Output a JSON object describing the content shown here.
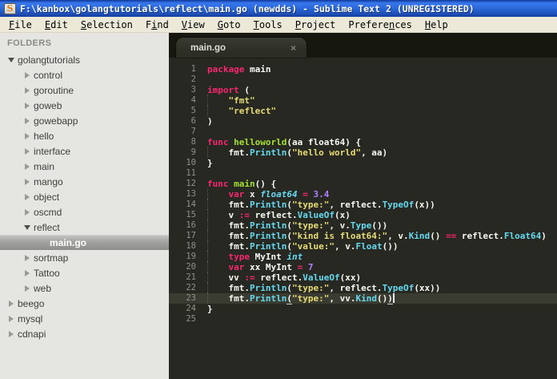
{
  "window": {
    "title": "F:\\kanbox\\golangtutorials\\reflect\\main.go (newdds) - Sublime Text 2 (UNREGISTERED)",
    "app_icon_glyph": "S"
  },
  "menubar": {
    "items": [
      {
        "label": "File",
        "mnemonic_index": 0
      },
      {
        "label": "Edit",
        "mnemonic_index": 0
      },
      {
        "label": "Selection",
        "mnemonic_index": 0
      },
      {
        "label": "Find",
        "mnemonic_index": 1
      },
      {
        "label": "View",
        "mnemonic_index": 0
      },
      {
        "label": "Goto",
        "mnemonic_index": 0
      },
      {
        "label": "Tools",
        "mnemonic_index": 0
      },
      {
        "label": "Project",
        "mnemonic_index": 0
      },
      {
        "label": "Preferences",
        "mnemonic_index": 7
      },
      {
        "label": "Help",
        "mnemonic_index": 0
      }
    ]
  },
  "sidebar": {
    "header": "FOLDERS",
    "items": [
      {
        "label": "golangtutorials",
        "level": 0,
        "type": "folder",
        "state": "expanded",
        "selected": false
      },
      {
        "label": "control",
        "level": 1,
        "type": "folder",
        "state": "collapsed",
        "selected": false
      },
      {
        "label": "goroutine",
        "level": 1,
        "type": "folder",
        "state": "collapsed",
        "selected": false
      },
      {
        "label": "goweb",
        "level": 1,
        "type": "folder",
        "state": "collapsed",
        "selected": false
      },
      {
        "label": "gowebapp",
        "level": 1,
        "type": "folder",
        "state": "collapsed",
        "selected": false
      },
      {
        "label": "hello",
        "level": 1,
        "type": "folder",
        "state": "collapsed",
        "selected": false
      },
      {
        "label": "interface",
        "level": 1,
        "type": "folder",
        "state": "collapsed",
        "selected": false
      },
      {
        "label": "main",
        "level": 1,
        "type": "folder",
        "state": "collapsed",
        "selected": false
      },
      {
        "label": "mango",
        "level": 1,
        "type": "folder",
        "state": "collapsed",
        "selected": false
      },
      {
        "label": "object",
        "level": 1,
        "type": "folder",
        "state": "collapsed",
        "selected": false
      },
      {
        "label": "oscmd",
        "level": 1,
        "type": "folder",
        "state": "collapsed",
        "selected": false
      },
      {
        "label": "reflect",
        "level": 1,
        "type": "folder",
        "state": "expanded",
        "selected": false
      },
      {
        "label": "main.go",
        "level": 2,
        "type": "file",
        "state": "none",
        "selected": true
      },
      {
        "label": "sortmap",
        "level": 1,
        "type": "folder",
        "state": "collapsed",
        "selected": false
      },
      {
        "label": "Tattoo",
        "level": 1,
        "type": "folder",
        "state": "collapsed",
        "selected": false
      },
      {
        "label": "web",
        "level": 1,
        "type": "folder",
        "state": "collapsed",
        "selected": false
      },
      {
        "label": "beego",
        "level": 0,
        "type": "folder",
        "state": "collapsed",
        "selected": false
      },
      {
        "label": "mysql",
        "level": 0,
        "type": "folder",
        "state": "collapsed",
        "selected": false
      },
      {
        "label": "cdnapi",
        "level": 0,
        "type": "folder",
        "state": "collapsed",
        "selected": false
      }
    ]
  },
  "editor": {
    "tab": {
      "label": "main.go",
      "close_glyph": "×",
      "active": true
    },
    "code": {
      "language": "go",
      "lines": [
        {
          "n": 1,
          "g": false,
          "cur": false,
          "seg": [
            [
              "kw",
              "package"
            ],
            [
              "p",
              " main"
            ]
          ]
        },
        {
          "n": 2,
          "g": false,
          "cur": false,
          "seg": []
        },
        {
          "n": 3,
          "g": false,
          "cur": false,
          "seg": [
            [
              "kw",
              "import"
            ],
            [
              "p",
              " ("
            ]
          ]
        },
        {
          "n": 4,
          "g": true,
          "cur": false,
          "seg": [
            [
              "p",
              "    "
            ],
            [
              "str",
              "\"fmt\""
            ]
          ]
        },
        {
          "n": 5,
          "g": true,
          "cur": false,
          "seg": [
            [
              "p",
              "    "
            ],
            [
              "str",
              "\"reflect\""
            ]
          ]
        },
        {
          "n": 6,
          "g": false,
          "cur": false,
          "seg": [
            [
              "p",
              ")"
            ]
          ]
        },
        {
          "n": 7,
          "g": false,
          "cur": false,
          "seg": []
        },
        {
          "n": 8,
          "g": false,
          "cur": false,
          "seg": [
            [
              "kw",
              "func"
            ],
            [
              "p",
              " "
            ],
            [
              "fn",
              "helloworld"
            ],
            [
              "p",
              "(aa float64) {"
            ]
          ]
        },
        {
          "n": 9,
          "g": true,
          "cur": false,
          "seg": [
            [
              "p",
              "    fmt."
            ],
            [
              "call",
              "Println"
            ],
            [
              "p",
              "("
            ],
            [
              "str",
              "\"hello world\""
            ],
            [
              "p",
              ", aa)"
            ]
          ]
        },
        {
          "n": 10,
          "g": false,
          "cur": false,
          "seg": [
            [
              "p",
              "}"
            ]
          ]
        },
        {
          "n": 11,
          "g": false,
          "cur": false,
          "seg": []
        },
        {
          "n": 12,
          "g": false,
          "cur": false,
          "seg": [
            [
              "kw",
              "func"
            ],
            [
              "p",
              " "
            ],
            [
              "fn",
              "main"
            ],
            [
              "p",
              "() {"
            ]
          ]
        },
        {
          "n": 13,
          "g": true,
          "cur": false,
          "seg": [
            [
              "p",
              "    "
            ],
            [
              "kw",
              "var"
            ],
            [
              "p",
              " x "
            ],
            [
              "typ",
              "float64"
            ],
            [
              "p",
              " "
            ],
            [
              "kw",
              "="
            ],
            [
              "p",
              " "
            ],
            [
              "num",
              "3.4"
            ]
          ]
        },
        {
          "n": 14,
          "g": true,
          "cur": false,
          "seg": [
            [
              "p",
              "    fmt."
            ],
            [
              "call",
              "Println"
            ],
            [
              "p",
              "("
            ],
            [
              "str",
              "\"type:\""
            ],
            [
              "p",
              ", reflect."
            ],
            [
              "call",
              "TypeOf"
            ],
            [
              "p",
              "(x))"
            ]
          ]
        },
        {
          "n": 15,
          "g": true,
          "cur": false,
          "seg": [
            [
              "p",
              "    v "
            ],
            [
              "kw",
              ":="
            ],
            [
              "p",
              " reflect."
            ],
            [
              "call",
              "ValueOf"
            ],
            [
              "p",
              "(x)"
            ]
          ]
        },
        {
          "n": 16,
          "g": true,
          "cur": false,
          "seg": [
            [
              "p",
              "    fmt."
            ],
            [
              "call",
              "Println"
            ],
            [
              "p",
              "("
            ],
            [
              "str",
              "\"type:\""
            ],
            [
              "p",
              ", v."
            ],
            [
              "call",
              "Type"
            ],
            [
              "p",
              "())"
            ]
          ]
        },
        {
          "n": 17,
          "g": true,
          "cur": false,
          "seg": [
            [
              "p",
              "    fmt."
            ],
            [
              "call",
              "Println"
            ],
            [
              "p",
              "("
            ],
            [
              "str",
              "\"kind is float64:\""
            ],
            [
              "p",
              ", v."
            ],
            [
              "call",
              "Kind"
            ],
            [
              "p",
              "() "
            ],
            [
              "kw",
              "=="
            ],
            [
              "p",
              " reflect."
            ],
            [
              "call",
              "Float64"
            ],
            [
              "p",
              ")"
            ]
          ]
        },
        {
          "n": 18,
          "g": true,
          "cur": false,
          "seg": [
            [
              "p",
              "    fmt."
            ],
            [
              "call",
              "Println"
            ],
            [
              "p",
              "("
            ],
            [
              "str",
              "\"value:\""
            ],
            [
              "p",
              ", v."
            ],
            [
              "call",
              "Float"
            ],
            [
              "p",
              "())"
            ]
          ]
        },
        {
          "n": 19,
          "g": true,
          "cur": false,
          "seg": [
            [
              "p",
              "    "
            ],
            [
              "kw",
              "type"
            ],
            [
              "p",
              " MyInt "
            ],
            [
              "typ",
              "int"
            ]
          ]
        },
        {
          "n": 20,
          "g": true,
          "cur": false,
          "seg": [
            [
              "p",
              "    "
            ],
            [
              "kw",
              "var"
            ],
            [
              "p",
              " xx MyInt "
            ],
            [
              "kw",
              "="
            ],
            [
              "p",
              " "
            ],
            [
              "num",
              "7"
            ]
          ]
        },
        {
          "n": 21,
          "g": true,
          "cur": false,
          "seg": [
            [
              "p",
              "    vv "
            ],
            [
              "kw",
              ":="
            ],
            [
              "p",
              " reflect."
            ],
            [
              "call",
              "ValueOf"
            ],
            [
              "p",
              "(xx)"
            ]
          ]
        },
        {
          "n": 22,
          "g": true,
          "cur": false,
          "seg": [
            [
              "p",
              "    fmt."
            ],
            [
              "call",
              "Println"
            ],
            [
              "p",
              "("
            ],
            [
              "str",
              "\"type:\""
            ],
            [
              "p",
              ", reflect."
            ],
            [
              "call",
              "TypeOf"
            ],
            [
              "p",
              "(xx))"
            ]
          ]
        },
        {
          "n": 23,
          "g": true,
          "cur": true,
          "seg": [
            [
              "p",
              "    fmt."
            ],
            [
              "call",
              "Println"
            ],
            [
              "pu",
              "("
            ],
            [
              "str",
              "\"type:\""
            ],
            [
              "p",
              ", vv."
            ],
            [
              "call",
              "Kind"
            ],
            [
              "p",
              "()"
            ],
            [
              "pu",
              ")"
            ],
            [
              "caret",
              ""
            ]
          ]
        },
        {
          "n": 24,
          "g": false,
          "cur": false,
          "seg": [
            [
              "p",
              "}"
            ]
          ]
        },
        {
          "n": 25,
          "g": false,
          "cur": false,
          "seg": []
        }
      ]
    }
  },
  "colors": {
    "titlebar_blue": "#2c69dc",
    "menubar_bg": "#ece9d8",
    "sidebar_bg": "#e5e5e2",
    "editor_bg": "#272822",
    "tabbar_bg": "#16170f",
    "current_line_bg": "#3a3b31",
    "keyword": "#f92672",
    "function_name": "#a6e22e",
    "string": "#e6db74",
    "number": "#ae81ff",
    "type_italic": "#66d9ef",
    "call": "#66d9ef",
    "plain_text": "#f8f8f2",
    "line_number": "#8f908a"
  }
}
